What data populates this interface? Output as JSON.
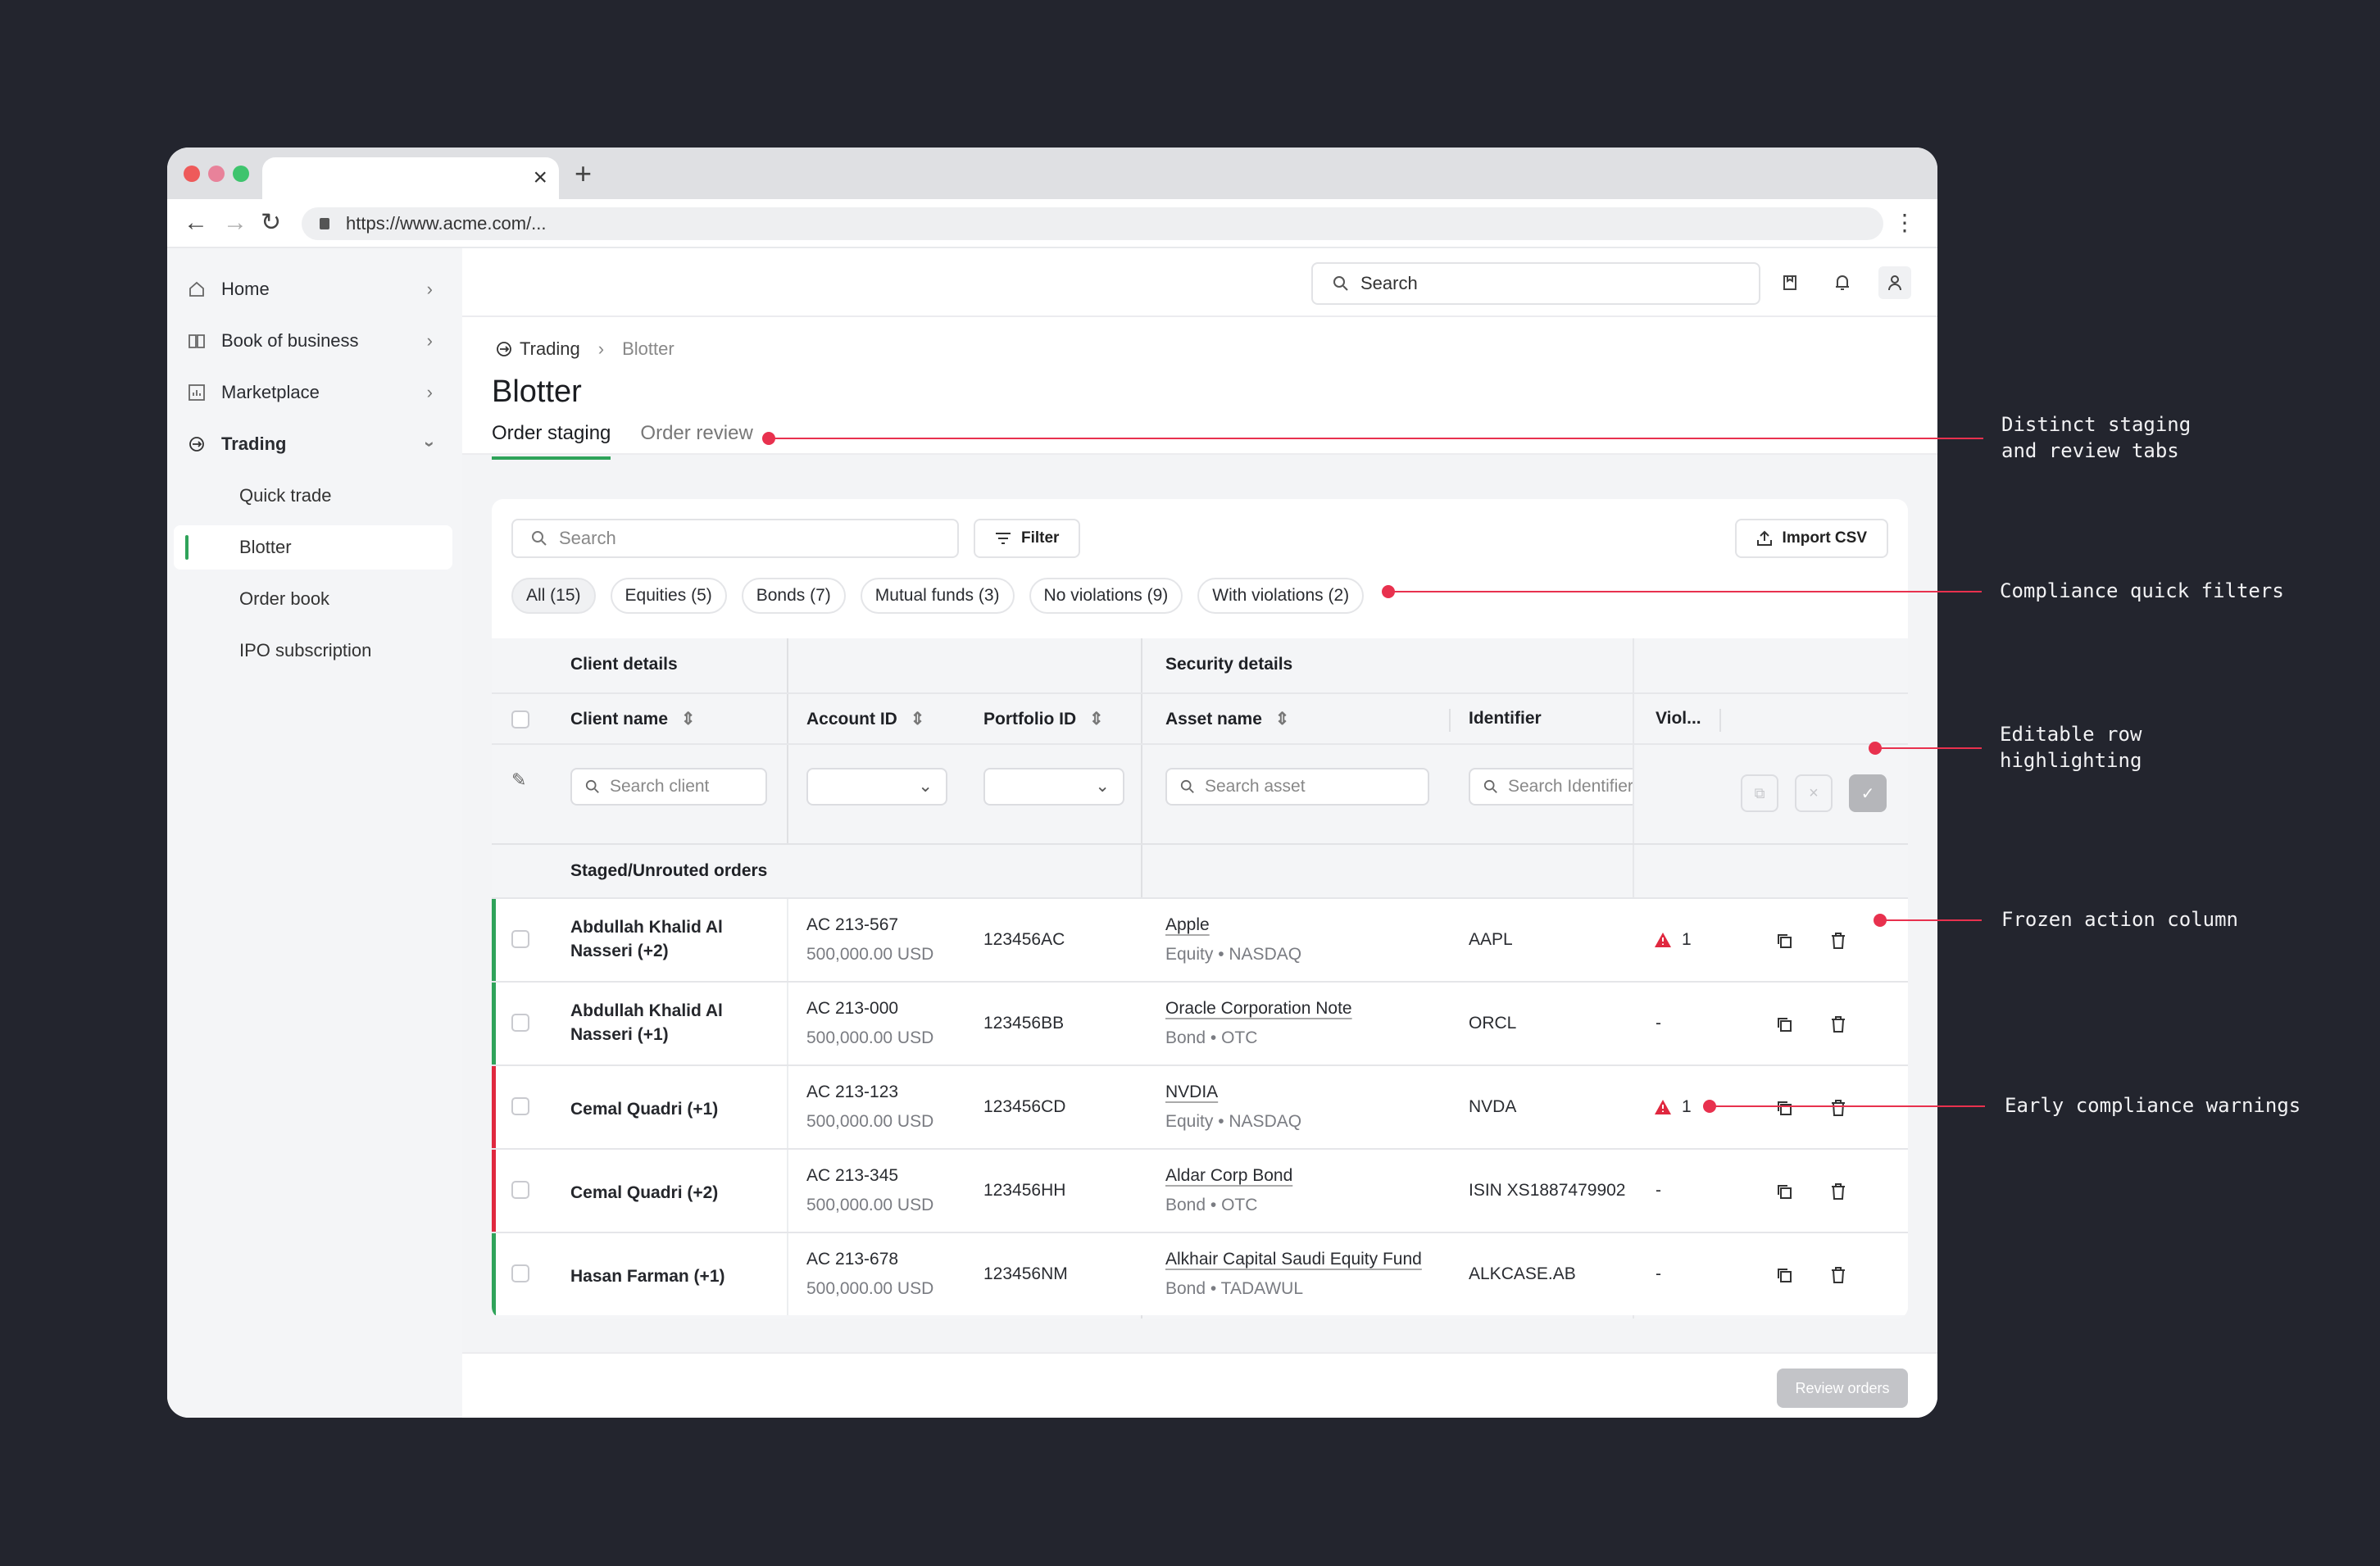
{
  "browser": {
    "url": "https://www.acme.com/...",
    "tab_close": "×",
    "new_tab": "+",
    "back": "←",
    "forward": "→",
    "reload": "↻",
    "menu": "⋮"
  },
  "sidebar": {
    "items": [
      {
        "label": "Home",
        "icon": "home-icon"
      },
      {
        "label": "Book of business",
        "icon": "book-icon"
      },
      {
        "label": "Marketplace",
        "icon": "chart-icon"
      },
      {
        "label": "Trading",
        "icon": "trading-icon"
      }
    ],
    "sub_items": [
      "Quick trade",
      "Blotter",
      "Order book",
      "IPO subscription"
    ]
  },
  "topbar": {
    "search_placeholder": "Search"
  },
  "breadcrumb": {
    "root": "Trading",
    "current": "Blotter"
  },
  "page": {
    "title": "Blotter",
    "tabs": [
      "Order staging",
      "Order review"
    ]
  },
  "toolbar": {
    "search_placeholder": "Search",
    "filter_label": "Filter",
    "import_label": "Import CSV"
  },
  "chips": [
    "All (15)",
    "Equities (5)",
    "Bonds (7)",
    "Mutual funds (3)",
    "No violations (9)",
    "With violations (2)"
  ],
  "table": {
    "groups": {
      "client": "Client details",
      "security": "Security details"
    },
    "columns": {
      "client": "Client name",
      "account": "Account ID",
      "portfolio": "Portfolio ID",
      "asset": "Asset name",
      "identifier": "Identifier",
      "violations": "Viol..."
    },
    "filters": {
      "client": "Search client",
      "asset": "Search asset",
      "identifier": "Search Identifier"
    },
    "section": "Staged/Unrouted orders",
    "rows": [
      {
        "client": "Abdullah Khalid Al Nasseri (+2)",
        "account": "AC 213-567",
        "amount": "500,000.00 USD",
        "portfolio": "123456AC",
        "asset": "Apple",
        "asset_meta": "Equity • NASDAQ",
        "identifier": "AAPL",
        "violations": "1",
        "status": "ok"
      },
      {
        "client": "Abdullah Khalid Al Nasseri (+1)",
        "account": "AC 213-000",
        "amount": "500,000.00 USD",
        "portfolio": "123456BB",
        "asset": "Oracle Corporation Note",
        "asset_meta": "Bond • OTC",
        "identifier": "ORCL",
        "violations": "-",
        "status": "ok"
      },
      {
        "client": "Cemal Quadri (+1)",
        "account": "AC 213-123",
        "amount": "500,000.00 USD",
        "portfolio": "123456CD",
        "asset": "NVDIA",
        "asset_meta": "Equity • NASDAQ",
        "identifier": "NVDA",
        "violations": "1",
        "status": "error"
      },
      {
        "client": "Cemal Quadri (+2)",
        "account": "AC 213-345",
        "amount": "500,000.00 USD",
        "portfolio": "123456HH",
        "asset": "Aldar Corp Bond",
        "asset_meta": "Bond • OTC",
        "identifier": "ISIN XS1887479902",
        "violations": "-",
        "status": "error"
      },
      {
        "client": "Hasan Farman (+1)",
        "account": "AC 213-678",
        "amount": "500,000.00 USD",
        "portfolio": "123456NM",
        "asset": "Alkhair Capital Saudi Equity Fund",
        "asset_meta": "Bond • TADAWUL",
        "identifier": "ALKCASE.AB",
        "violations": "-",
        "status": "ok"
      }
    ]
  },
  "footer": {
    "review_label": "Review orders"
  },
  "annotations": [
    "Distinct staging\nand review tabs",
    "Compliance quick filters",
    "Editable row\nhighlighting",
    "Frozen action column",
    "Early compliance warnings"
  ],
  "colors": {
    "accent_green": "#2fa35a",
    "error_red": "#e0283f",
    "annotation_red": "#e8314e",
    "background": "#23252e"
  }
}
